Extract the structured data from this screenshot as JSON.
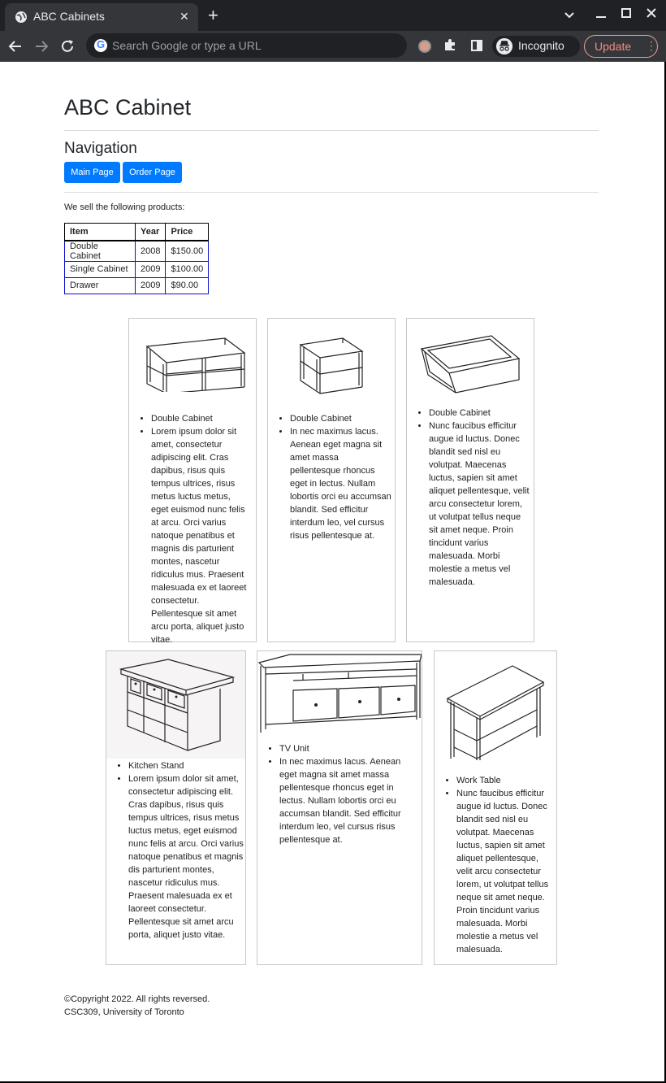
{
  "browser": {
    "tab_title": "ABC Cabinets",
    "tab_close": "✕",
    "new_tab": "+",
    "omnibox_placeholder": "Search Google or type a URL",
    "incognito_label": "Incognito",
    "update_label": "Update",
    "update_menu": "⋮"
  },
  "header": {
    "title": "ABC Cabinet",
    "nav_heading": "Navigation",
    "buttons": [
      "Main Page",
      "Order Page"
    ]
  },
  "intro": "We sell the following products:",
  "table": {
    "headers": [
      "Item",
      "Year",
      "Price"
    ],
    "rows": [
      [
        "Double Cabinet",
        "2008",
        "$150.00"
      ],
      [
        "Single Cabinet",
        "2009",
        "$100.00"
      ],
      [
        "Drawer",
        "2009",
        "$90.00"
      ]
    ]
  },
  "products": [
    {
      "name": "Double Cabinet",
      "desc": "Lorem ipsum dolor sit amet, consectetur adipiscing elit. Cras dapibus, risus quis tempus ultrices, risus metus luctus metus, eget euismod nunc felis at arcu. Orci varius natoque penatibus et magnis dis parturient montes, nascetur ridiculus mus. Praesent malesuada ex et laoreet consectetur. Pellentesque sit amet arcu porta, aliquet justo vitae."
    },
    {
      "name": "Double Cabinet",
      "desc": "In nec maximus lacus. Aenean eget magna sit amet massa pellentesque rhoncus eget in lectus. Nullam lobortis orci eu accumsan blandit. Sed efficitur interdum leo, vel cursus risus pellentesque at."
    },
    {
      "name": "Double Cabinet",
      "desc": "Nunc faucibus efficitur augue id luctus. Donec blandit sed nisl eu volutpat. Maecenas luctus, sapien sit amet aliquet pellentesque, velit arcu consectetur lorem, ut volutpat tellus neque sit amet neque. Proin tincidunt varius malesuada. Morbi molestie a metus vel malesuada."
    },
    {
      "name": "Kitchen Stand",
      "desc": "Lorem ipsum dolor sit amet, consectetur adipiscing elit. Cras dapibus, risus quis tempus ultrices, risus metus luctus metus, eget euismod nunc felis at arcu. Orci varius natoque penatibus et magnis dis parturient montes, nascetur ridiculus mus. Praesent malesuada ex et laoreet consectetur. Pellentesque sit amet arcu porta, aliquet justo vitae."
    },
    {
      "name": "TV Unit",
      "desc": "In nec maximus lacus. Aenean eget magna sit amet massa pellentesque rhoncus eget in lectus. Nullam lobortis orci eu accumsan blandit. Sed efficitur interdum leo, vel cursus risus pellentesque at."
    },
    {
      "name": "Work Table",
      "desc": "Nunc faucibus efficitur augue id luctus. Donec blandit sed nisl eu volutpat. Maecenas luctus, sapien sit amet aliquet pellentesque, velit arcu consectetur lorem, ut volutpat tellus neque sit amet neque. Proin tincidunt varius malesuada. Morbi molestie a metus vel malesuada."
    }
  ],
  "footer": {
    "copyright": "©Copyright 2022. All rights reversed.",
    "course": "CSC309, University of Toronto"
  }
}
